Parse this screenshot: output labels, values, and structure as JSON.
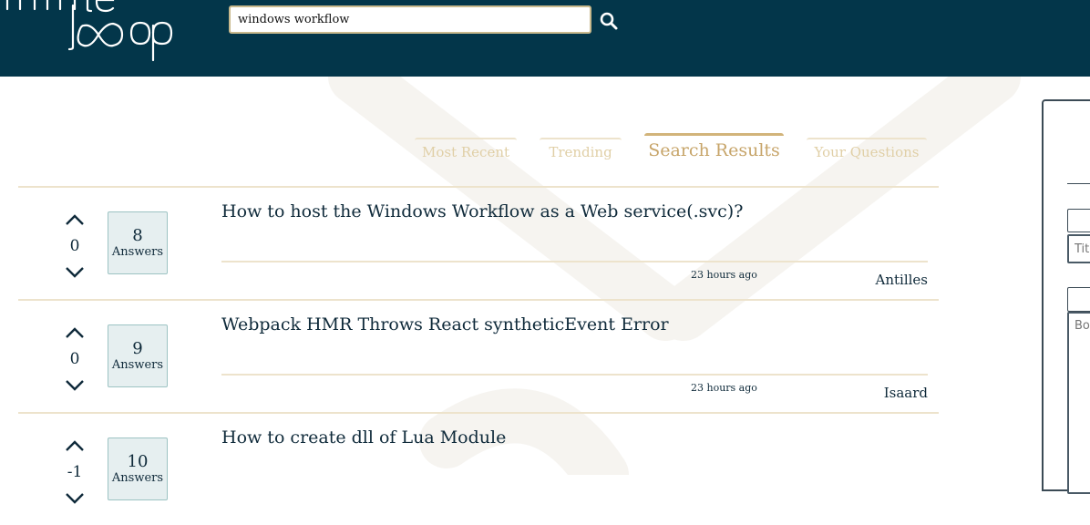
{
  "header": {
    "logo_text": "infinite loop",
    "search": {
      "value": "windows workflow",
      "placeholder": ""
    },
    "search_icon": "search-icon"
  },
  "colors": {
    "header_bg": "#03364a",
    "accent_gold": "#c7a56a",
    "answers_bg": "#e6eff0"
  },
  "tabs": [
    {
      "label": "Most Recent",
      "active": false
    },
    {
      "label": "Trending",
      "active": false
    },
    {
      "label": "Search Results",
      "active": true
    },
    {
      "label": "Your Questions",
      "active": false
    }
  ],
  "questions": [
    {
      "score": "0",
      "answers": "8",
      "answers_label": "Answers",
      "title": "How to host the Windows Workflow as a Web service(.svc)?",
      "time": "23 hours ago",
      "author": "Antilles"
    },
    {
      "score": "0",
      "answers": "9",
      "answers_label": "Answers",
      "title": "Webpack HMR Throws React syntheticEvent Error",
      "time": "23 hours ago",
      "author": "Isaard"
    },
    {
      "score": "-1",
      "answers": "10",
      "answers_label": "Answers",
      "title": "How to create dll of Lua Module",
      "time": "",
      "author": ""
    }
  ],
  "side_panel": {
    "title_placeholder": "Title",
    "body_placeholder": "Body"
  }
}
